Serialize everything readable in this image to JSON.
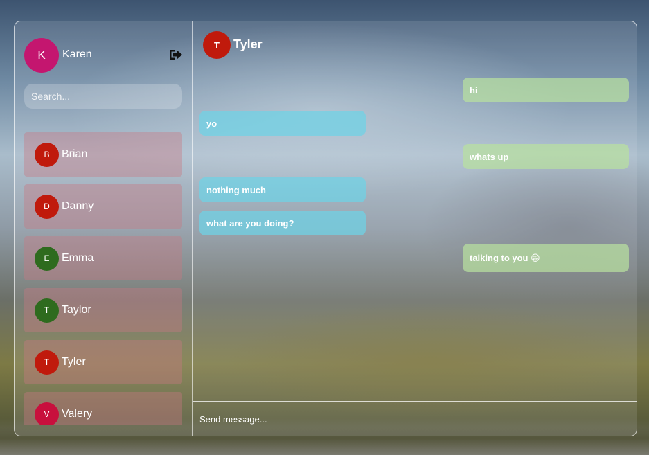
{
  "current_user": {
    "initial": "K",
    "name": "Karen",
    "avatar_color": "#c4166f"
  },
  "search": {
    "placeholder": "Search..."
  },
  "contacts": [
    {
      "initial": "B",
      "name": "Brian",
      "avatar_color": "#c01a0c"
    },
    {
      "initial": "D",
      "name": "Danny",
      "avatar_color": "#c01a0c"
    },
    {
      "initial": "E",
      "name": "Emma",
      "avatar_color": "#2e6b1e"
    },
    {
      "initial": "T",
      "name": "Taylor",
      "avatar_color": "#2e6b1e"
    },
    {
      "initial": "T",
      "name": "Tyler",
      "avatar_color": "#c01a0c"
    },
    {
      "initial": "V",
      "name": "Valery",
      "avatar_color": "#c8103d"
    }
  ],
  "chat": {
    "header": {
      "initial": "T",
      "name": "Tyler",
      "avatar_color": "#c01a0c"
    },
    "messages": [
      {
        "direction": "out",
        "text": "hi"
      },
      {
        "direction": "in",
        "text": "yo"
      },
      {
        "direction": "out",
        "text": "whats up"
      },
      {
        "direction": "in",
        "text": "nothing much"
      },
      {
        "direction": "in",
        "text": "what are you doing?"
      },
      {
        "direction": "out",
        "text": "talking to you 😁"
      }
    ],
    "composer_placeholder": "Send message..."
  },
  "icons": {
    "logout": "sign-out-icon"
  }
}
